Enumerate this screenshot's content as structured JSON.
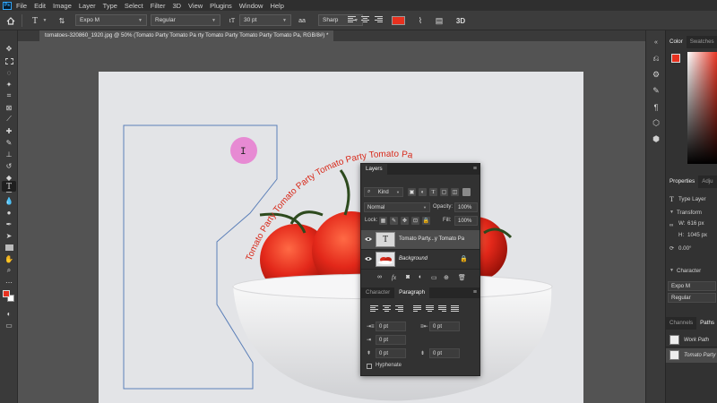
{
  "menubar": {
    "items": [
      "File",
      "Edit",
      "Image",
      "Layer",
      "Type",
      "Select",
      "Filter",
      "3D",
      "View",
      "Plugins",
      "Window",
      "Help"
    ]
  },
  "options_bar": {
    "font_family": "Expo M",
    "font_style": "Regular",
    "font_size": "30 pt",
    "anti_alias": "Sharp",
    "text_color": "#e8311f",
    "mode_3d": "3D"
  },
  "document": {
    "tab_title": "tomatoes-320860_1920.jpg @ 50% (Tomato Party Tomato Pa  rty Tomato Party Tomato Party Tomato Pa, RGB/8#) *",
    "path_text": "Tomato Party Tomato Party Tomato Party Tomato Pa"
  },
  "layers_panel": {
    "tab_label": "Layers",
    "kind_filter": "Kind",
    "blend_mode": "Normal",
    "opacity_label": "Opacity:",
    "opacity_value": "100%",
    "lock_label": "Lock:",
    "fill_label": "Fill:",
    "fill_value": "100%",
    "layers": [
      {
        "name": "Tomato Party...y Tomato Pa",
        "type": "text",
        "selected": true,
        "thumb_glyph": "T"
      },
      {
        "name": "Background",
        "type": "image",
        "selected": false
      }
    ]
  },
  "paragraph_panel": {
    "tabs": [
      "Character",
      "Paragraph"
    ],
    "active_tab": "Paragraph",
    "indent_left": "0 pt",
    "indent_right": "0 pt",
    "indent_first": "0 pt",
    "space_before": "0 pt",
    "space_after": "0 pt",
    "hyphenate_label": "Hyphenate"
  },
  "right_panel": {
    "color_tabs": [
      "Color",
      "Swatches"
    ],
    "properties_tabs": [
      "Properties",
      "Adju"
    ],
    "layer_kind": "Type Layer",
    "transform_label": "Transform",
    "width_label": "W:",
    "width": "616 px",
    "height_label": "H:",
    "height": "1045 px",
    "angle": "0.00°",
    "character_label": "Character",
    "font_family": "Expo M",
    "font_style": "Regular",
    "bottom_tabs": [
      "Channels",
      "Paths"
    ],
    "paths": [
      "Work Path",
      "Tomato Party"
    ]
  },
  "colors": {
    "accent_red": "#e8311f",
    "cursor_highlight": "#e77fd0",
    "path_line": "#5b7fb8"
  },
  "icons": {
    "toolbar": [
      "move-icon",
      "marquee-icon",
      "lasso-icon",
      "magic-wand-icon",
      "crop-icon",
      "frame-icon",
      "eyedropper-icon",
      "healing-icon",
      "brush-icon",
      "stamp-icon",
      "history-brush-icon",
      "eraser-icon",
      "gradient-icon",
      "blur-icon",
      "dodge-icon",
      "pen-icon",
      "type-icon",
      "path-select-icon",
      "rectangle-icon",
      "hand-icon",
      "zoom-icon",
      "more-icon"
    ]
  }
}
